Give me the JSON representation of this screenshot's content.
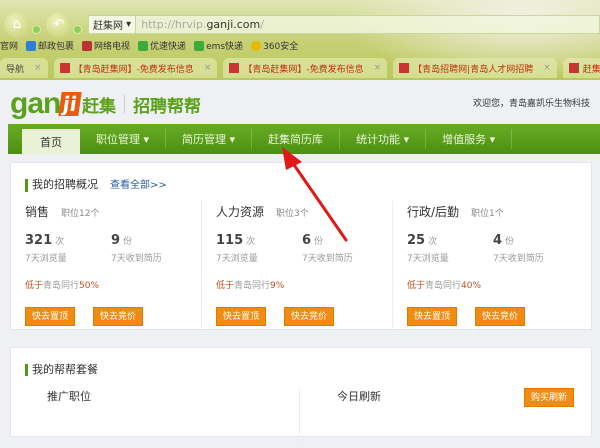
{
  "browser": {
    "search_engine": "赶集网",
    "url_prefix": "http://hrvip.",
    "url_domain": "ganji.com",
    "url_suffix": "/",
    "bookmarks": [
      "官网",
      "邮政包裹",
      "网络电视",
      "优速快递",
      "ems快递",
      "360安全"
    ],
    "tabs": [
      "导航",
      "【青岛赶集网】-免费发布信息",
      "【青岛赶集网】-免费发布信息",
      "【青岛招聘网|青岛人才网招聘",
      "赶集网-招"
    ],
    "tab_close": "×"
  },
  "header": {
    "logo_en": "gan",
    "logo_ji": "ji",
    "logo_cn": "赶集",
    "product": "招聘帮帮",
    "welcome": "欢迎您，青岛嘉凯乐生物科技"
  },
  "nav": [
    {
      "label": "首页",
      "dropdown": false,
      "active": true
    },
    {
      "label": "职位管理",
      "dropdown": true
    },
    {
      "label": "简历管理",
      "dropdown": true
    },
    {
      "label": "赶集简历库",
      "dropdown": false
    },
    {
      "label": "统计功能",
      "dropdown": true
    },
    {
      "label": "增值服务",
      "dropdown": true
    }
  ],
  "overview": {
    "title": "我的招聘概况",
    "view_all": "查看全部>>",
    "columns": [
      {
        "name": "销售",
        "jobs": "职位12个",
        "views": "321",
        "views_unit": "次",
        "views_label": "7天浏览量",
        "resumes": "9",
        "resumes_unit": "份",
        "resumes_label": "7天收到简历",
        "low_prefix": "低于",
        "low_text": "青岛同行",
        "low_pct": "50%",
        "btn1": "快去置顶",
        "btn2": "快去竞价"
      },
      {
        "name": "人力资源",
        "jobs": "职位3个",
        "views": "115",
        "views_unit": "次",
        "views_label": "7天浏览量",
        "resumes": "6",
        "resumes_unit": "份",
        "resumes_label": "7天收到简历",
        "low_prefix": "低于",
        "low_text": "青岛同行",
        "low_pct": "9%",
        "btn1": "快去置顶",
        "btn2": "快去竞价"
      },
      {
        "name": "行政/后勤",
        "jobs": "职位1个",
        "views": "25",
        "views_unit": "次",
        "views_label": "7天浏览量",
        "resumes": "4",
        "resumes_unit": "份",
        "resumes_label": "7天收到简历",
        "low_prefix": "低于",
        "low_text": "青岛同行",
        "low_pct": "40%",
        "btn1": "快去置顶",
        "btn2": "快去竞价"
      }
    ]
  },
  "package": {
    "title": "我的帮帮套餐",
    "promoted": "推广职位",
    "today_refresh": "今日刷新",
    "buy_refresh": "购买刷新"
  },
  "colors": {
    "green": "#5aa21b",
    "orange": "#f08c13",
    "arrow": "#e01818"
  }
}
